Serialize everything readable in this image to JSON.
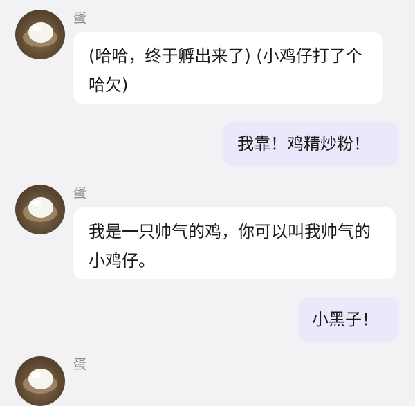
{
  "messages": [
    {
      "sender": "蛋",
      "direction": "incoming",
      "text": "(哈哈，终于孵出来了) (小鸡仔打了个哈欠)"
    },
    {
      "direction": "outgoing",
      "text": "我靠！鸡精炒粉！"
    },
    {
      "sender": "蛋",
      "direction": "incoming",
      "text": "我是一只帅气的鸡，你可以叫我帅气的小鸡仔。"
    },
    {
      "direction": "outgoing",
      "text": "小黑子！"
    },
    {
      "sender": "蛋",
      "direction": "incoming",
      "text": ""
    }
  ],
  "colors": {
    "background": "#f2f2f4",
    "incoming_bubble": "#ffffff",
    "outgoing_bubble": "#e9e9fb",
    "sender_name": "#8c8c8c"
  },
  "icons": {
    "avatar": "egg-avatar"
  }
}
